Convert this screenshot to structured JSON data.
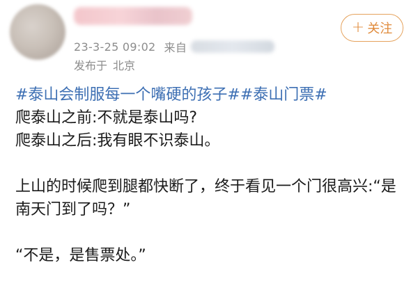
{
  "post": {
    "header": {
      "timestamp": "23-3-25 09:02",
      "source_prefix": "来自",
      "location_label": "发布于",
      "location_value": "北京",
      "follow_label": "关注",
      "follow_icon": "plus-icon"
    },
    "hashtags": [
      "#泰山会制服每一个嘴硬的孩子#",
      "#泰山门票#"
    ],
    "lines": {
      "before": "爬泰山之前:不就是泰山吗?",
      "after": "爬泰山之后:我有眼不识泰山。",
      "story_1": "上山的时候爬到腿都快断了，终于看见一个门很高兴:“是南天门到了吗？”",
      "reply": "“不是，是售票处。”"
    },
    "colors": {
      "hashtag": "#3d6fb3",
      "follow_accent": "#e08a3a",
      "meta_text": "#8c8c8c"
    }
  }
}
